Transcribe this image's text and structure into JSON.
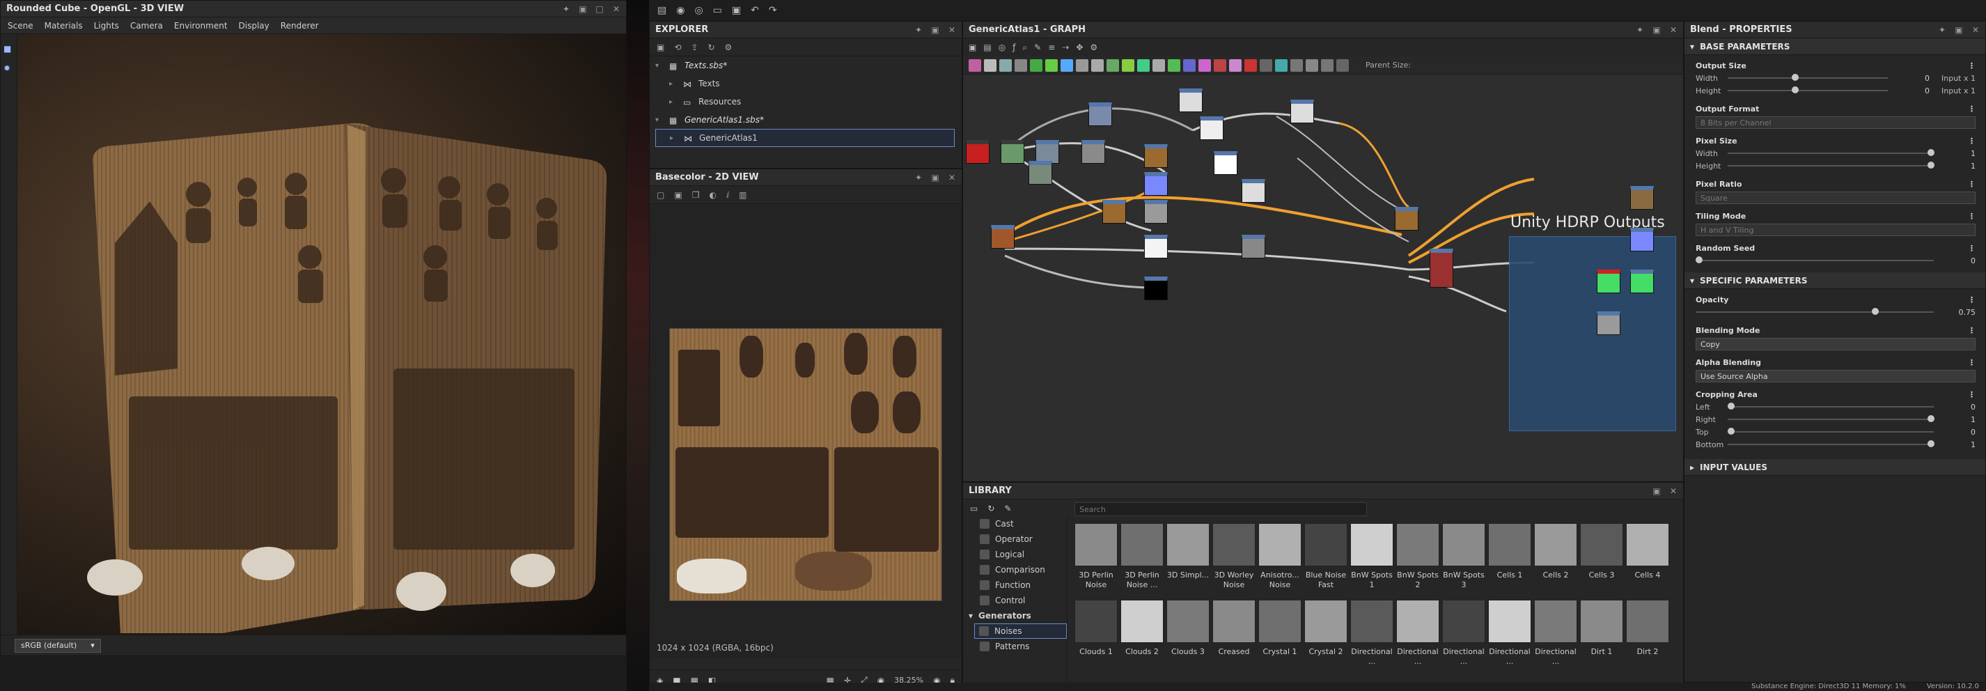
{
  "view3d": {
    "title": "Rounded Cube - OpenGL - 3D VIEW",
    "menu": [
      "Scene",
      "Materials",
      "Lights",
      "Camera",
      "Environment",
      "Display",
      "Renderer"
    ],
    "colorspace": "sRGB (default)"
  },
  "explorer": {
    "title": "EXPLORER",
    "tree": [
      {
        "label": "Texts.sbs*",
        "italic": true,
        "caret": "v"
      },
      {
        "label": "Texts",
        "italic": false,
        "caret": ">"
      },
      {
        "label": "Resources",
        "italic": false,
        "caret": ">"
      },
      {
        "label": "GenericAtlas1.sbs*",
        "italic": true,
        "caret": "v"
      },
      {
        "label": "GenericAtlas1",
        "italic": false,
        "caret": ">"
      }
    ]
  },
  "view2d": {
    "title": "Basecolor - 2D VIEW",
    "info": "1024 x 1024 (RGBA, 16bpc)",
    "zoom": "38.25%"
  },
  "graph": {
    "title": "GenericAtlas1 - GRAPH",
    "parent_size_label": "Parent Size:",
    "frame_title": "Unity HDRP Outputs"
  },
  "library": {
    "title": "LIBRARY",
    "search_placeholder": "Search",
    "categories": [
      {
        "label": "Cast",
        "group": false
      },
      {
        "label": "Operator",
        "group": false
      },
      {
        "label": "Logical",
        "group": false
      },
      {
        "label": "Comparison",
        "group": false
      },
      {
        "label": "Function",
        "group": false
      },
      {
        "label": "Control",
        "group": false
      },
      {
        "label": "Generators",
        "group": true
      },
      {
        "label": "Noises",
        "group": false,
        "selected": true
      },
      {
        "label": "Patterns",
        "group": false
      }
    ],
    "items": [
      "3D Perlin Noise",
      "3D Perlin Noise ...",
      "3D Simpl...",
      "3D Worley Noise",
      "Anisotro... Noise",
      "Blue Noise Fast",
      "BnW Spots 1",
      "BnW Spots 2",
      "BnW Spots 3",
      "Cells 1",
      "Cells 2",
      "Cells 3",
      "Cells 4",
      "Clouds 1",
      "Clouds 2",
      "Clouds 3",
      "Creased",
      "Crystal 1",
      "Crystal 2",
      "Directional ...",
      "Directional ...",
      "Directional ...",
      "Directional ...",
      "Directional ...",
      "Dirt 1",
      "Dirt 2"
    ]
  },
  "properties": {
    "title": "Blend - PROPERTIES",
    "base_section": "BASE PARAMETERS",
    "output_size": {
      "label": "Output Size",
      "width_label": "Width",
      "height_label": "Height",
      "width_val": "0",
      "height_val": "0",
      "width_suffix": "Input x 1",
      "height_suffix": "Input x 1"
    },
    "output_format": {
      "label": "Output Format",
      "value": "8 Bits per Channel"
    },
    "pixel_size": {
      "label": "Pixel Size",
      "width_label": "Width",
      "height_label": "Height",
      "width_val": "1",
      "height_val": "1"
    },
    "pixel_ratio": {
      "label": "Pixel Ratio",
      "value": "Square"
    },
    "tiling_mode": {
      "label": "Tiling Mode",
      "value": "H and V Tiling"
    },
    "random_seed": {
      "label": "Random Seed",
      "value": "0"
    },
    "specific_section": "SPECIFIC PARAMETERS",
    "opacity": {
      "label": "Opacity",
      "value": "0.75"
    },
    "blending_mode": {
      "label": "Blending Mode",
      "value": "Copy"
    },
    "alpha_blending": {
      "label": "Alpha Blending",
      "value": "Use Source Alpha"
    },
    "cropping": {
      "label": "Cropping Area",
      "left_label": "Left",
      "right_label": "Right",
      "top_label": "Top",
      "bottom_label": "Bottom",
      "left_val": "0",
      "right_val": "1",
      "top_val": "0",
      "bottom_val": "1"
    },
    "input_section": "INPUT VALUES"
  },
  "status": {
    "engine": "Substance Engine: Direct3D 11  Memory: 1%",
    "version": "Version: 10.2.0"
  }
}
